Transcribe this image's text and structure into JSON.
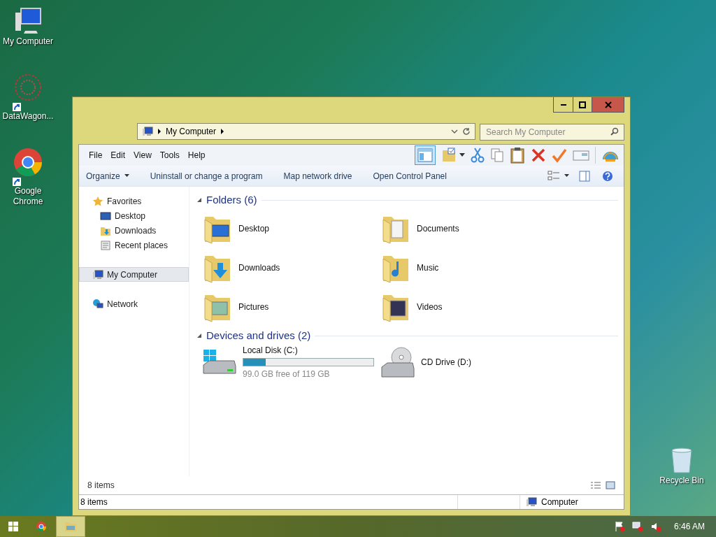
{
  "desktop_icons": [
    {
      "label": "My Computer",
      "kind": "computer",
      "shortcut": false
    },
    {
      "label": "DataWagon...",
      "kind": "web",
      "shortcut": true
    },
    {
      "label": "Google\nChrome",
      "kind": "chrome",
      "shortcut": true
    },
    {
      "label": "Recycle Bin",
      "kind": "bin",
      "shortcut": false
    }
  ],
  "window": {
    "address": {
      "path": "My Computer"
    },
    "search": {
      "placeholder": "Search My Computer"
    },
    "menu": [
      "File",
      "Edit",
      "View",
      "Tools",
      "Help"
    ],
    "commands": [
      {
        "label": "Organize",
        "dropdown": true
      },
      {
        "label": "Uninstall or change a program",
        "dropdown": false
      },
      {
        "label": "Map network drive",
        "dropdown": false
      },
      {
        "label": "Open Control Panel",
        "dropdown": false
      }
    ],
    "sidebar": [
      {
        "label": "Favorites",
        "kind": "star",
        "selected": false,
        "children": [
          {
            "label": "Desktop",
            "kind": "desktop",
            "selected": false
          },
          {
            "label": "Downloads",
            "kind": "downloads",
            "selected": false
          },
          {
            "label": "Recent places",
            "kind": "recent",
            "selected": false
          }
        ]
      },
      {
        "label": "My Computer",
        "kind": "computer",
        "selected": true
      },
      {
        "label": "Network",
        "kind": "network",
        "selected": false
      }
    ],
    "sections": [
      {
        "title": "Folders (6)",
        "expanded": true,
        "items": [
          {
            "label": "Desktop",
            "kind": "desktop"
          },
          {
            "label": "Documents",
            "kind": "documents"
          },
          {
            "label": "Downloads",
            "kind": "downloads"
          },
          {
            "label": "Music",
            "kind": "music"
          },
          {
            "label": "Pictures",
            "kind": "pictures"
          },
          {
            "label": "Videos",
            "kind": "videos"
          }
        ]
      },
      {
        "title": "Devices and drives (2)",
        "expanded": true,
        "items": [
          {
            "label": "Local Disk (C:)",
            "kind": "disk",
            "level": 0.17,
            "detail": "99.0 GB free of 119 GB"
          },
          {
            "label": "CD Drive (D:)",
            "kind": "cd"
          }
        ]
      }
    ],
    "footer": "8 items",
    "status_bar": {
      "left": "8 items",
      "right": "Computer"
    }
  },
  "taskbar": {
    "items": [
      {
        "kind": "chrome",
        "active": false
      },
      {
        "kind": "explorer",
        "active": true
      }
    ],
    "clock": "6:46 AM"
  }
}
